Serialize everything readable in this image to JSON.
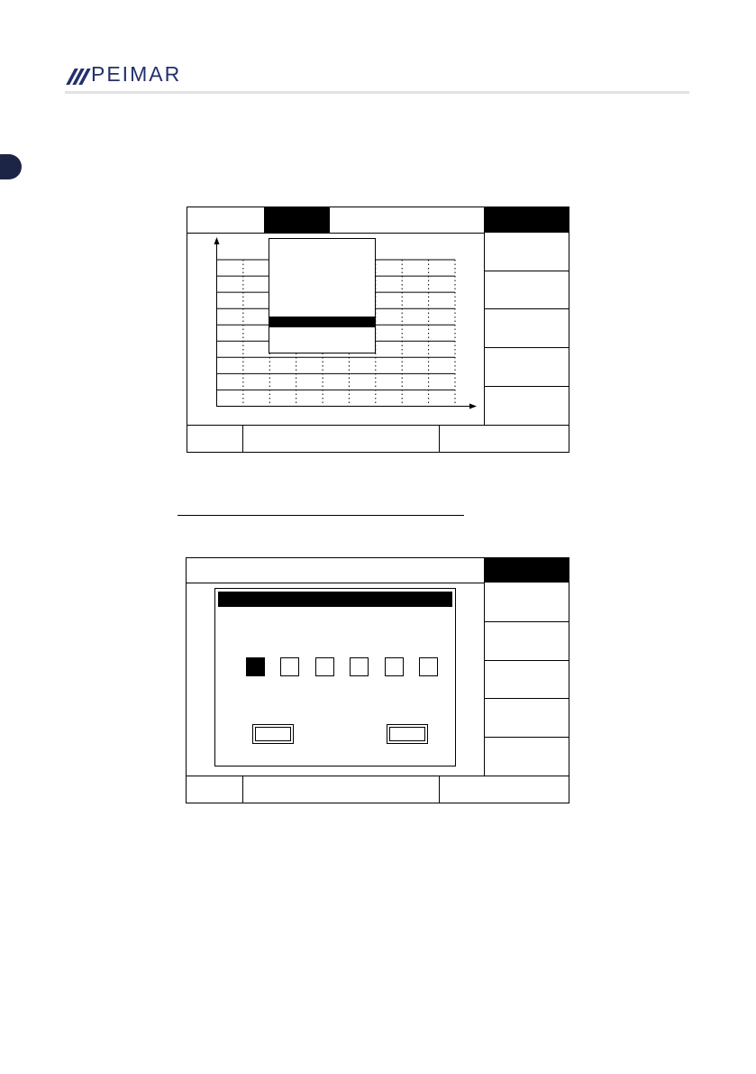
{
  "header": {
    "brand": "PEIMAR",
    "brand_color": "#24306b",
    "rule_color": "#e3e3e3",
    "tab_color": "#1c2546"
  },
  "screen_chart": {
    "chart": {
      "rows": 10,
      "columns": 9,
      "grid": "dotted"
    },
    "popup": {
      "highlighted_row": 1
    }
  },
  "screen_password": {
    "digit_boxes": 6,
    "active_digit": 1
  },
  "icons": {
    "logo": "slashes-logo-icon",
    "axis_arrow": "arrow-icon"
  }
}
